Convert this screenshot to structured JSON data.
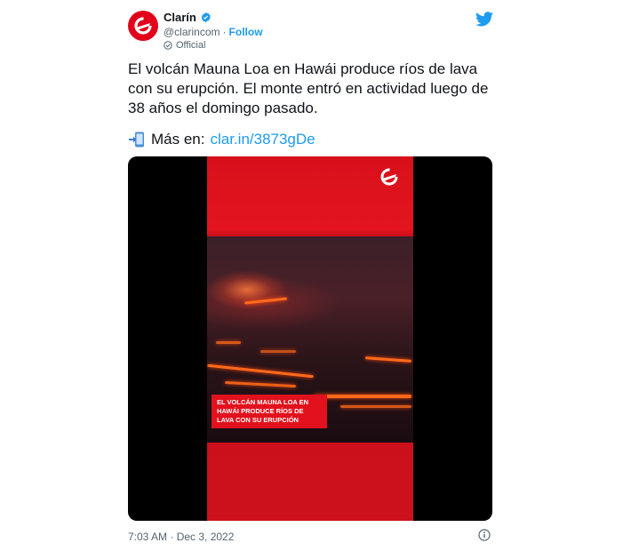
{
  "account": {
    "name": "Clarín",
    "handle": "@clarincom",
    "separator": "·",
    "follow_label": "Follow",
    "official_label": "Official"
  },
  "tweet": {
    "text": "El volcán Mauna Loa en Hawái produce ríos de lava con su erupción. El monte entró en actividad luego de 38 años el domingo pasado.",
    "link_prefix": "Más en:",
    "link_text": "clar.in/3873gDe",
    "timestamp": "7:03 AM · Dec 3, 2022"
  },
  "media": {
    "caption": "EL VOLCÁN MAUNA LOA EN HAWÁI PRODUCE RÍOS DE LAVA CON SU ERUPCIÓN"
  },
  "icons": {
    "avatar": "clarin-logo-icon",
    "verified": "verified-badge-icon",
    "official": "official-check-icon",
    "bird": "twitter-bird-icon",
    "phone": "mobile-phone-arrow-icon",
    "info": "info-icon"
  },
  "colors": {
    "brand_red": "#e2001a",
    "link_blue": "#1d9bf0",
    "secondary_text": "#536471"
  }
}
